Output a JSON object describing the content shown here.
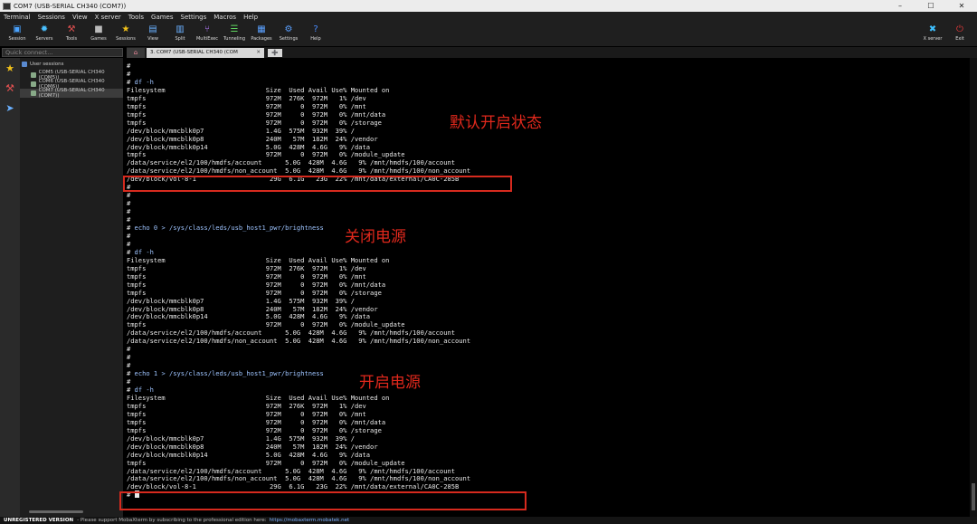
{
  "window": {
    "title": "COM7  (USB-SERIAL CH340 (COM7))",
    "controls": [
      "–",
      "☐",
      "✕"
    ]
  },
  "menu": [
    "Terminal",
    "Sessions",
    "View",
    "X server",
    "Tools",
    "Games",
    "Settings",
    "Macros",
    "Help"
  ],
  "toolbar": {
    "buttons": [
      {
        "label": "Session",
        "icon": "monitor-icon",
        "glyph": "▣",
        "color": "#4aa3ff"
      },
      {
        "label": "Servers",
        "icon": "servers-icon",
        "glyph": "✹",
        "color": "#4ac0ff"
      },
      {
        "label": "Tools",
        "icon": "tools-icon",
        "glyph": "⚒",
        "color": "#e05050"
      },
      {
        "label": "Games",
        "icon": "gamepad-icon",
        "glyph": "■",
        "color": "#bbbbbb"
      },
      {
        "label": "Sessions",
        "icon": "star-icon",
        "glyph": "★",
        "color": "#f2c21a"
      },
      {
        "label": "View",
        "icon": "view-icon",
        "glyph": "▤",
        "color": "#6ab0ff"
      },
      {
        "label": "Split",
        "icon": "split-icon",
        "glyph": "▥",
        "color": "#6ab0ff"
      },
      {
        "label": "MultiExec",
        "icon": "multiexec-icon",
        "glyph": "⑂",
        "color": "#b57aff"
      },
      {
        "label": "Tunneling",
        "icon": "tunneling-icon",
        "glyph": "☰",
        "color": "#5fd35f"
      },
      {
        "label": "Packages",
        "icon": "packages-icon",
        "glyph": "▦",
        "color": "#5aa0ff"
      },
      {
        "label": "Settings",
        "icon": "gear-icon",
        "glyph": "⚙",
        "color": "#5aa0ff"
      },
      {
        "label": "Help",
        "icon": "help-icon",
        "glyph": "?",
        "color": "#4a8cff"
      }
    ],
    "right_buttons": [
      {
        "label": "X server",
        "icon": "xserver-icon",
        "glyph": "✖",
        "color": "#3ec0ff"
      },
      {
        "label": "Exit",
        "icon": "power-icon",
        "glyph": "⏻",
        "color": "#e03a3a"
      }
    ]
  },
  "quick_connect": {
    "placeholder": "Quick connect..."
  },
  "tabs": {
    "home_glyph": "⌂",
    "active_label": "3. COM7  (USB-SERIAL CH340 (COM",
    "close_glyph": "✕",
    "new_glyph": "➕"
  },
  "sidebar": {
    "root": "User sessions",
    "items": [
      {
        "label": "COM5  (USB-SERIAL CH340 (COM5))",
        "active": false
      },
      {
        "label": "COM6  (USB-SERIAL CH340 (COM6))",
        "active": false
      },
      {
        "label": "COM7  (USB-SERIAL CH340 (COM7))",
        "active": true
      }
    ]
  },
  "terminal": {
    "lines": [
      {
        "text": "#",
        "cmd": false
      },
      {
        "text": "#",
        "cmd": false
      },
      {
        "text": "# df -h",
        "cmd": true
      },
      {
        "text": "Filesystem                          Size  Used Avail Use% Mounted on",
        "cmd": false
      },
      {
        "text": "tmpfs                               972M  276K  972M   1% /dev",
        "cmd": false
      },
      {
        "text": "tmpfs                               972M     0  972M   0% /mnt",
        "cmd": false
      },
      {
        "text": "tmpfs                               972M     0  972M   0% /mnt/data",
        "cmd": false
      },
      {
        "text": "tmpfs                               972M     0  972M   0% /storage",
        "cmd": false
      },
      {
        "text": "/dev/block/mmcblk0p7                1.4G  575M  932M  39% /",
        "cmd": false
      },
      {
        "text": "/dev/block/mmcblk0p8                240M   57M  182M  24% /vendor",
        "cmd": false
      },
      {
        "text": "/dev/block/mmcblk0p14               5.0G  428M  4.6G   9% /data",
        "cmd": false
      },
      {
        "text": "tmpfs                               972M     0  972M   0% /module_update",
        "cmd": false
      },
      {
        "text": "/data/service/el2/100/hmdfs/account      5.0G  428M  4.6G   9% /mnt/hmdfs/100/account",
        "cmd": false
      },
      {
        "text": "/data/service/el2/100/hmdfs/non_account  5.0G  428M  4.6G   9% /mnt/hmdfs/100/non_account",
        "cmd": false
      },
      {
        "text": "/dev/block/vol-8-1                   29G  6.1G   23G  22% /mnt/data/external/CA0C-285B",
        "cmd": false
      },
      {
        "text": "#",
        "cmd": false
      },
      {
        "text": "#",
        "cmd": false
      },
      {
        "text": "#",
        "cmd": false
      },
      {
        "text": "#",
        "cmd": false
      },
      {
        "text": "#",
        "cmd": false
      },
      {
        "text": "# echo 0 > /sys/class/leds/usb_host1_pwr/brightness",
        "cmd": true
      },
      {
        "text": "#",
        "cmd": false
      },
      {
        "text": "#",
        "cmd": false
      },
      {
        "text": "# df -h",
        "cmd": true
      },
      {
        "text": "Filesystem                          Size  Used Avail Use% Mounted on",
        "cmd": false
      },
      {
        "text": "tmpfs                               972M  276K  972M   1% /dev",
        "cmd": false
      },
      {
        "text": "tmpfs                               972M     0  972M   0% /mnt",
        "cmd": false
      },
      {
        "text": "tmpfs                               972M     0  972M   0% /mnt/data",
        "cmd": false
      },
      {
        "text": "tmpfs                               972M     0  972M   0% /storage",
        "cmd": false
      },
      {
        "text": "/dev/block/mmcblk0p7                1.4G  575M  932M  39% /",
        "cmd": false
      },
      {
        "text": "/dev/block/mmcblk0p8                240M   57M  182M  24% /vendor",
        "cmd": false
      },
      {
        "text": "/dev/block/mmcblk0p14               5.0G  428M  4.6G   9% /data",
        "cmd": false
      },
      {
        "text": "tmpfs                               972M     0  972M   0% /module_update",
        "cmd": false
      },
      {
        "text": "/data/service/el2/100/hmdfs/account      5.0G  428M  4.6G   9% /mnt/hmdfs/100/account",
        "cmd": false
      },
      {
        "text": "/data/service/el2/100/hmdfs/non_account  5.0G  428M  4.6G   9% /mnt/hmdfs/100/non_account",
        "cmd": false
      },
      {
        "text": "#",
        "cmd": false
      },
      {
        "text": "#",
        "cmd": false
      },
      {
        "text": "#",
        "cmd": false
      },
      {
        "text": "# echo 1 > /sys/class/leds/usb_host1_pwr/brightness",
        "cmd": true
      },
      {
        "text": "#",
        "cmd": false
      },
      {
        "text": "# df -h",
        "cmd": true
      },
      {
        "text": "Filesystem                          Size  Used Avail Use% Mounted on",
        "cmd": false
      },
      {
        "text": "tmpfs                               972M  276K  972M   1% /dev",
        "cmd": false
      },
      {
        "text": "tmpfs                               972M     0  972M   0% /mnt",
        "cmd": false
      },
      {
        "text": "tmpfs                               972M     0  972M   0% /mnt/data",
        "cmd": false
      },
      {
        "text": "tmpfs                               972M     0  972M   0% /storage",
        "cmd": false
      },
      {
        "text": "/dev/block/mmcblk0p7                1.4G  575M  932M  39% /",
        "cmd": false
      },
      {
        "text": "/dev/block/mmcblk0p8                240M   57M  182M  24% /vendor",
        "cmd": false
      },
      {
        "text": "/dev/block/mmcblk0p14               5.0G  428M  4.6G   9% /data",
        "cmd": false
      },
      {
        "text": "tmpfs                               972M     0  972M   0% /module_update",
        "cmd": false
      },
      {
        "text": "/data/service/el2/100/hmdfs/account      5.0G  428M  4.6G   9% /mnt/hmdfs/100/account",
        "cmd": false
      },
      {
        "text": "/data/service/el2/100/hmdfs/non_account  5.0G  428M  4.6G   9% /mnt/hmdfs/100/non_account",
        "cmd": false
      },
      {
        "text": "/dev/block/vol-8-1                   29G  6.1G   23G  22% /mnt/data/external/CA0C-285B",
        "cmd": false
      },
      {
        "text": "# ",
        "cmd": false,
        "cursor": true
      }
    ]
  },
  "annotations": [
    {
      "text": "默认开启状态"
    },
    {
      "text": "关闭电源"
    },
    {
      "text": "开启电源"
    }
  ],
  "status": {
    "unregistered": "UNREGISTERED VERSION",
    "message": " -  Please support MobaXterm by subscribing to the professional edition here:",
    "url": "https://mobaxterm.mobatek.net"
  }
}
